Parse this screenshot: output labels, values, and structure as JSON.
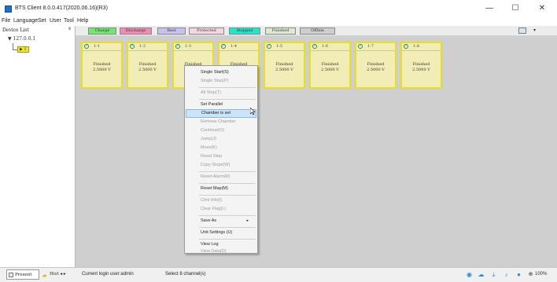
{
  "window": {
    "title": "BTS Client 8.0.0.417(2020.06.16)(R3)",
    "minimize": "—",
    "maximize": "☐",
    "close": "✕"
  },
  "menu": [
    "File",
    "Language",
    "Set",
    "User",
    "Tool",
    "Help"
  ],
  "legend": [
    {
      "label": "Charge",
      "bg": "#6ee86e"
    },
    {
      "label": "Discharge",
      "bg": "#f28ab4"
    },
    {
      "label": "Rest",
      "bg": "#c9c0f2"
    },
    {
      "label": "Protected",
      "bg": "#f7d6e3"
    },
    {
      "label": "Stopped",
      "bg": "#1fe8c9"
    },
    {
      "label": "Finished",
      "bg": "#dcead3"
    },
    {
      "label": "Offline",
      "bg": "#cfcfcf"
    }
  ],
  "device_list": {
    "title": "Device List",
    "pin": "ᵠ",
    "node": "▼ 127.0.0.1",
    "channel": "1"
  },
  "channels": [
    {
      "num": "1-1",
      "status": "Finished",
      "value": "2.5000 V"
    },
    {
      "num": "1-2",
      "status": "Finished",
      "value": "2.5000 V"
    },
    {
      "num": "1-3",
      "status": "Finished",
      "value": "2"
    },
    {
      "num": "1-4",
      "status": "Finished",
      "value": ""
    },
    {
      "num": "1-5",
      "status": "Finished",
      "value": "2.5000 V"
    },
    {
      "num": "1-6",
      "status": "Finished",
      "value": "2.5000 V"
    },
    {
      "num": "1-7",
      "status": "Finished",
      "value": "2.5000 V"
    },
    {
      "num": "1-8",
      "status": "Finished",
      "value": "2.5000 V"
    }
  ],
  "context_menu": [
    {
      "label": "Single Start(S)",
      "state": "enabled"
    },
    {
      "label": "Single Stop(P)",
      "state": "disabled"
    },
    {
      "label": "All Stop(T)",
      "state": "disabled"
    },
    {
      "label": "Set Parallel",
      "state": "enabled"
    },
    {
      "label": "Chamber is set",
      "state": "highlighted"
    },
    {
      "label": "Remove Chamber",
      "state": "disabled"
    },
    {
      "label": "Continue(O)",
      "state": "disabled"
    },
    {
      "label": "Jump(J)",
      "state": "disabled"
    },
    {
      "label": "Move(K)",
      "state": "disabled"
    },
    {
      "label": "Reset Step",
      "state": "disabled"
    },
    {
      "label": "Copy Steps(W)",
      "state": "disabled"
    },
    {
      "label": "Reset Alarm(R)",
      "state": "disabled"
    },
    {
      "label": "Reset Map(M)",
      "state": "enabled"
    },
    {
      "label": "Chnl Info(I)",
      "state": "disabled"
    },
    {
      "label": "Clear Flag(L)",
      "state": "disabled"
    },
    {
      "label": "Save As",
      "state": "enabled",
      "submenu": "▸"
    },
    {
      "label": "Unit Settings (U)",
      "state": "enabled"
    },
    {
      "label": "View Log",
      "state": "enabled"
    },
    {
      "label": "View Data(D)",
      "state": "disabled"
    }
  ],
  "bottom_tabs": {
    "present": "Present",
    "hist": "Hist ◂ ▸"
  },
  "status": {
    "login": "Current login user:admin",
    "selection": "Select 8 channel(s)",
    "zoom": "100%"
  },
  "colors": {
    "channel_border": "#e8e01e",
    "channel_fill": "#f2ecb6",
    "menu_highlight": "#cde3f7"
  }
}
